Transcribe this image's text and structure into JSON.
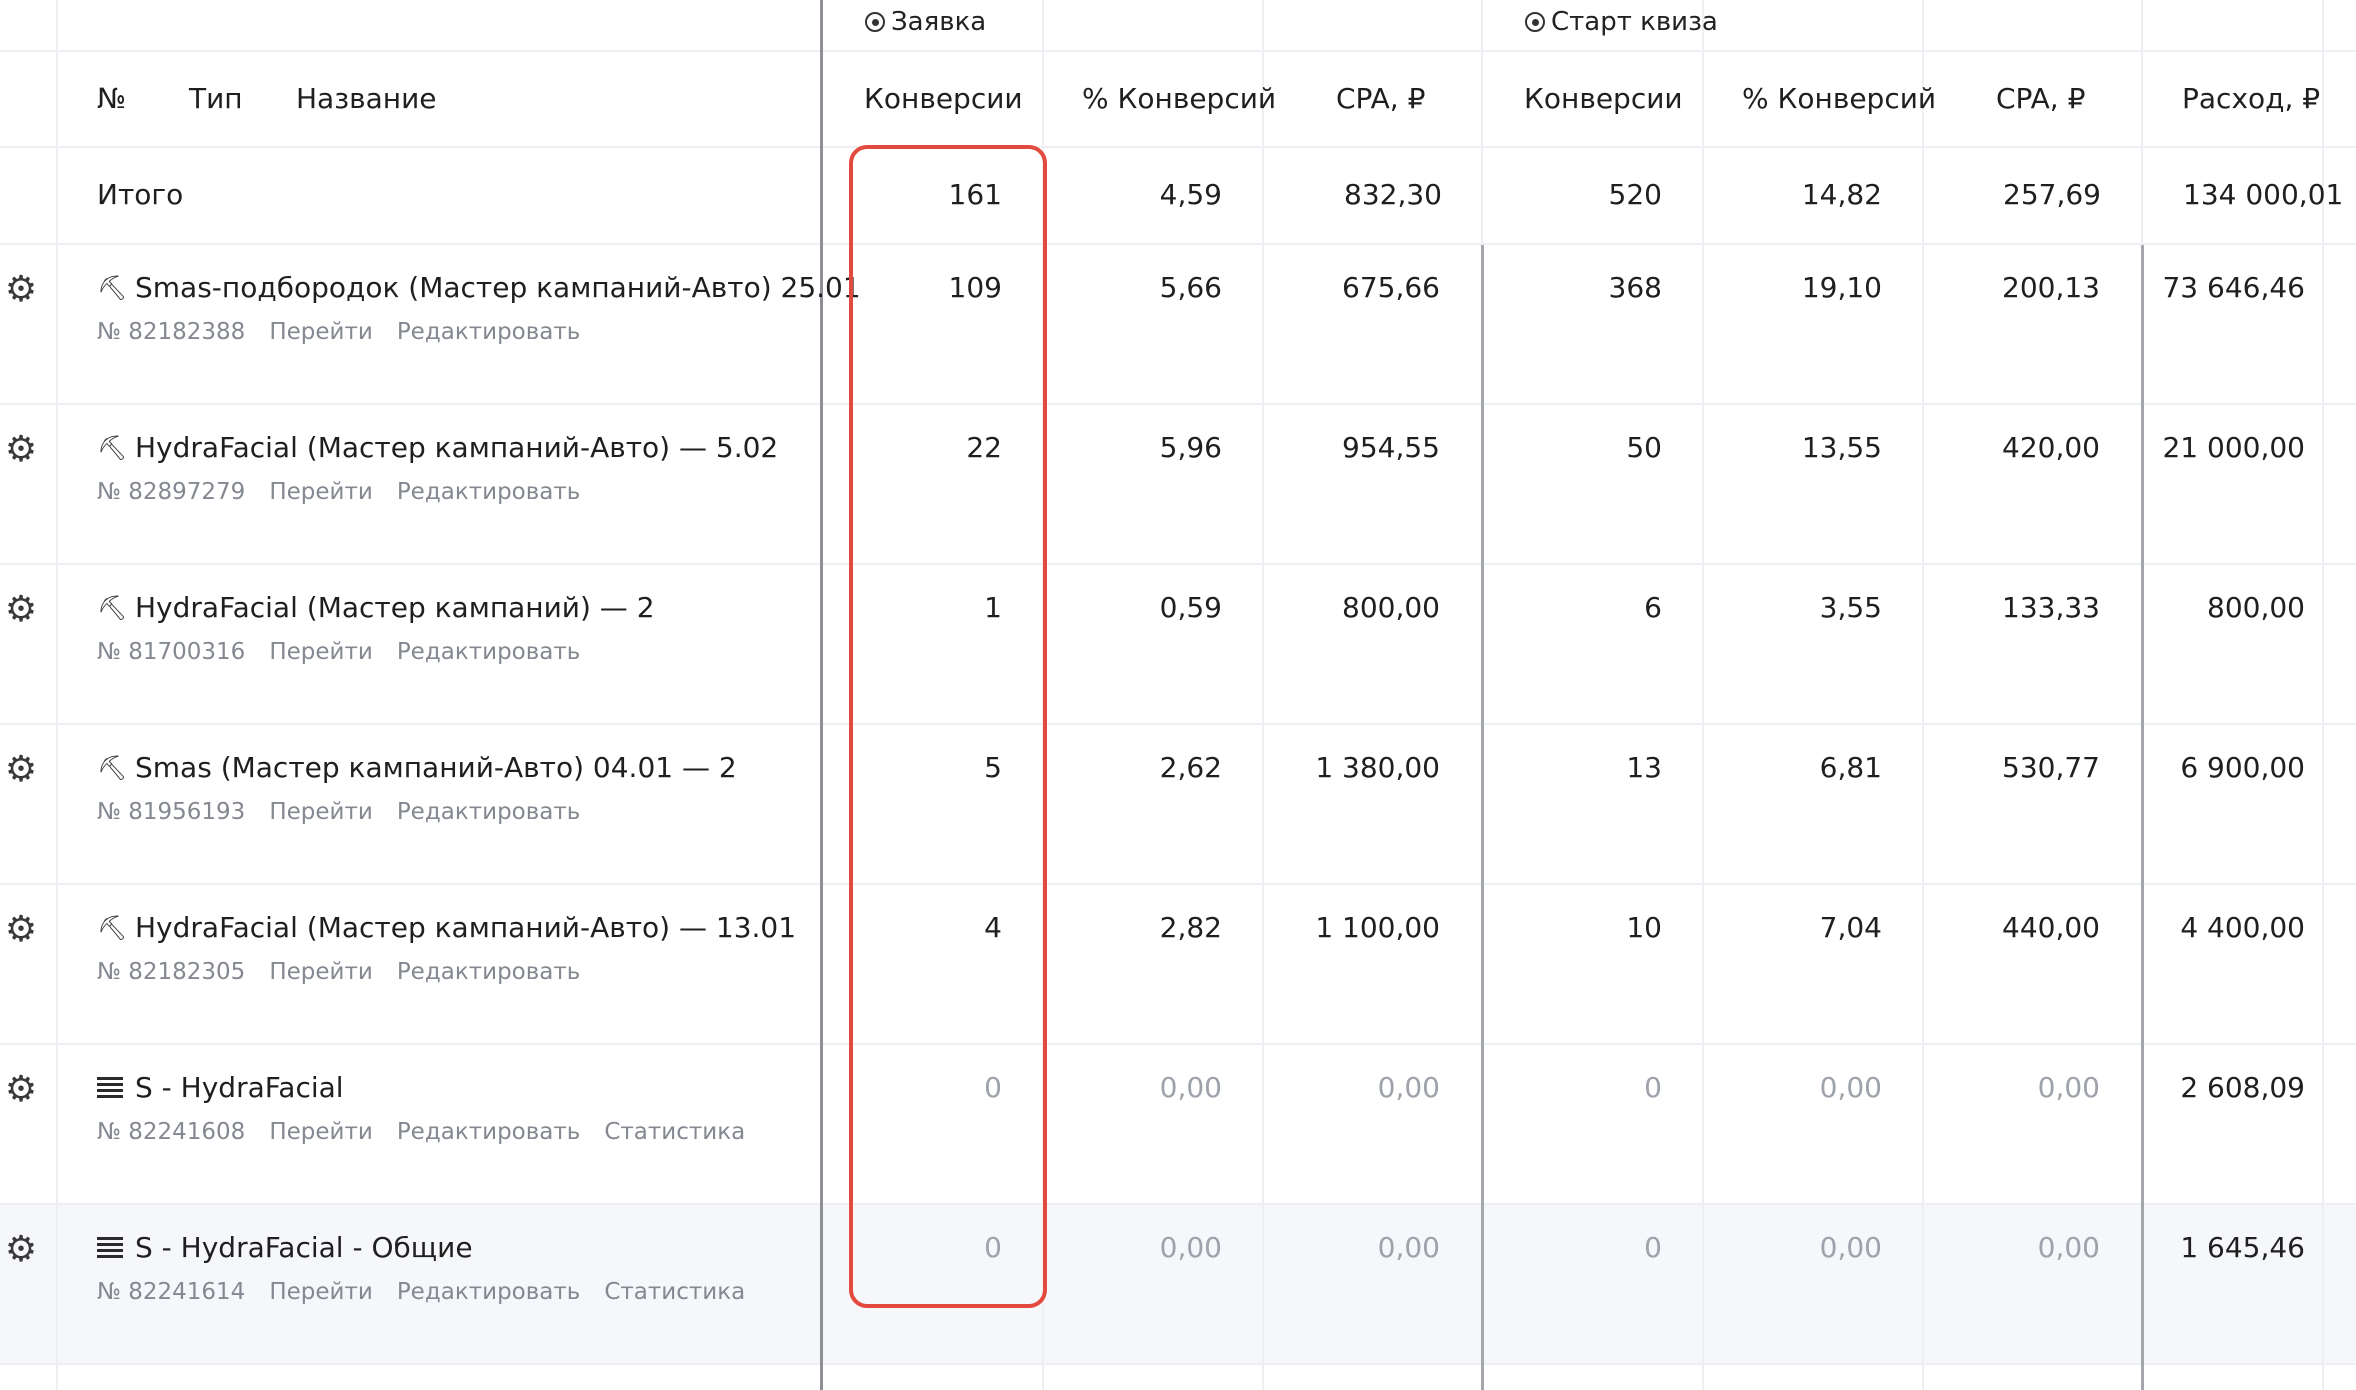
{
  "header_groups": {
    "group1": "Заявка",
    "group2": "Старт квиза"
  },
  "columns": {
    "no": "№",
    "type": "Тип",
    "name": "Название",
    "conv1": "Конверсии",
    "pct1": "% Конверсий",
    "cpa1": "CPA, ₽",
    "conv2": "Конверсии",
    "pct2": "% Конверсий",
    "cpa2": "CPA, ₽",
    "spend": "Расход, ₽"
  },
  "total": {
    "label": "Итого",
    "conv1": "161",
    "pct1": "4,59",
    "cpa1": "832,30",
    "conv2": "520",
    "pct2": "14,82",
    "cpa2": "257,69",
    "spend": "134 000,01"
  },
  "rows": [
    {
      "icon": "auto-icon",
      "title": "Smas-подбородок (Мастер кампаний-Авто) 25.01",
      "number": "№ 82182388",
      "link1": "Перейти",
      "link2": "Редактировать",
      "link3": "",
      "conv1": "109",
      "pct1": "5,66",
      "cpa1": "675,66",
      "conv2": "368",
      "pct2": "19,10",
      "cpa2": "200,13",
      "spend": "73 646,46"
    },
    {
      "icon": "auto-icon",
      "title": "HydraFacial (Мастер кампаний-Авто) — 5.02",
      "number": "№ 82897279",
      "link1": "Перейти",
      "link2": "Редактировать",
      "link3": "",
      "conv1": "22",
      "pct1": "5,96",
      "cpa1": "954,55",
      "conv2": "50",
      "pct2": "13,55",
      "cpa2": "420,00",
      "spend": "21 000,00"
    },
    {
      "icon": "auto-icon",
      "title": "HydraFacial (Мастер кампаний) — 2",
      "number": "№ 81700316",
      "link1": "Перейти",
      "link2": "Редактировать",
      "link3": "",
      "conv1": "1",
      "pct1": "0,59",
      "cpa1": "800,00",
      "conv2": "6",
      "pct2": "3,55",
      "cpa2": "133,33",
      "spend": "800,00"
    },
    {
      "icon": "auto-icon",
      "title": "Smas (Мастер кампаний-Авто) 04.01 — 2",
      "number": "№ 81956193",
      "link1": "Перейти",
      "link2": "Редактировать",
      "link3": "",
      "conv1": "5",
      "pct1": "2,62",
      "cpa1": "1 380,00",
      "conv2": "13",
      "pct2": "6,81",
      "cpa2": "530,77",
      "spend": "6 900,00"
    },
    {
      "icon": "auto-icon",
      "title": "HydraFacial (Мастер кампаний-Авто) — 13.01",
      "number": "№ 82182305",
      "link1": "Перейти",
      "link2": "Редактировать",
      "link3": "",
      "conv1": "4",
      "pct1": "2,82",
      "cpa1": "1 100,00",
      "conv2": "10",
      "pct2": "7,04",
      "cpa2": "440,00",
      "spend": "4 400,00"
    },
    {
      "icon": "list-icon",
      "title": "S - HydraFacial",
      "number": "№ 82241608",
      "link1": "Перейти",
      "link2": "Редактировать",
      "link3": "Статистика",
      "conv1": "0",
      "pct1": "0,00",
      "cpa1": "0,00",
      "conv2": "0",
      "pct2": "0,00",
      "cpa2": "0,00",
      "spend": "2 608,09"
    },
    {
      "icon": "list-icon",
      "title": "S - HydraFacial - Общие",
      "number": "№ 82241614",
      "link1": "Перейти",
      "link2": "Редактировать",
      "link3": "Статистика",
      "conv1": "0",
      "pct1": "0,00",
      "cpa1": "0,00",
      "conv2": "0",
      "pct2": "0,00",
      "cpa2": "0,00",
      "spend": "1 645,46"
    }
  ],
  "colors": {
    "highlight_box": "#e34a3d",
    "zero_text": "#9ea2aa",
    "link_text": "#848891",
    "hover_row": "#f6f7fa"
  }
}
